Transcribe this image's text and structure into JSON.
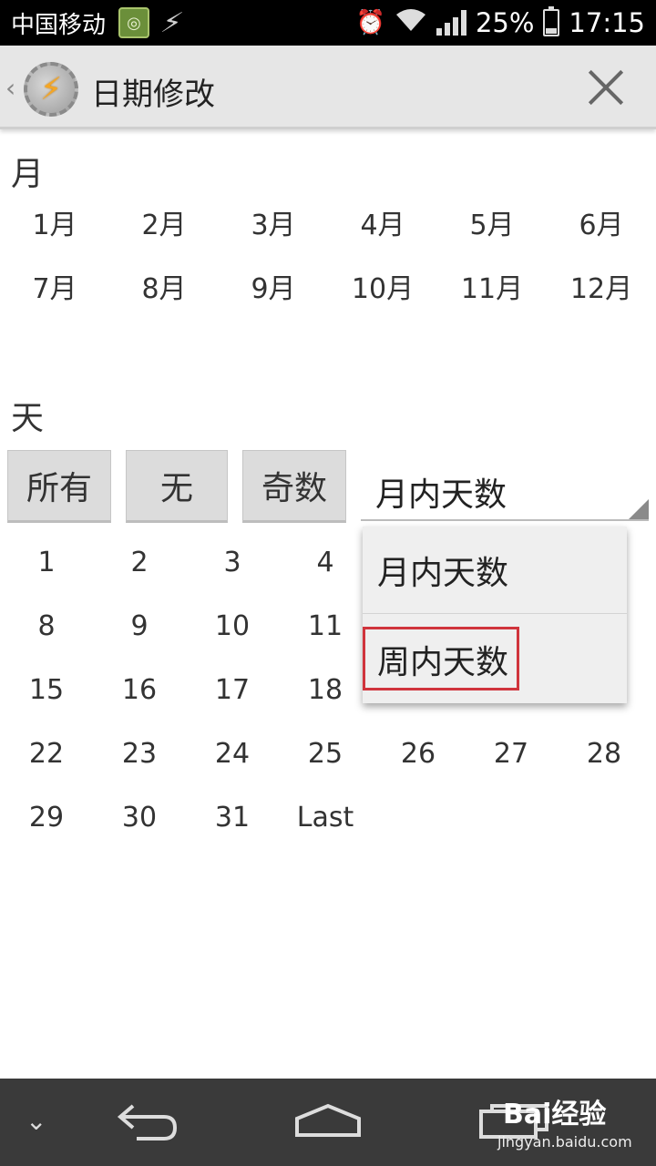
{
  "status_bar": {
    "carrier": "中国移动",
    "battery": "25%",
    "time": "17:15",
    "battery_level": 0.25,
    "icons": [
      "notification-app-icon",
      "flash-icon",
      "alarm-icon",
      "wifi-icon",
      "signal-icon",
      "battery-icon"
    ]
  },
  "title_bar": {
    "back_glyph": "‹",
    "title": "日期修改",
    "icons": [
      "back-chevron-icon",
      "app-lightning-gear-icon",
      "close-icon"
    ]
  },
  "month_section": {
    "label": "月",
    "months": [
      "1月",
      "2月",
      "3月",
      "4月",
      "5月",
      "6月",
      "7月",
      "8月",
      "9月",
      "10月",
      "11月",
      "12月"
    ]
  },
  "day_section": {
    "label": "天",
    "buttons": {
      "all": "所有",
      "none": "无",
      "odd": "奇数"
    },
    "spinner_value": "月内天数",
    "days_row1": [
      "1",
      "2",
      "3",
      "4"
    ],
    "days_row2": [
      "8",
      "9",
      "10",
      "11"
    ],
    "days_row3": [
      "15",
      "16",
      "17",
      "18"
    ],
    "days_row4": [
      "22",
      "23",
      "24",
      "25",
      "26",
      "27",
      "28"
    ],
    "days_row5": [
      "29",
      "30",
      "31",
      "Last"
    ]
  },
  "dropdown": {
    "options": [
      "月内天数",
      "周内天数"
    ],
    "highlight_color": "#d0343c"
  },
  "nav_bar": {
    "down_glyph": "⌄",
    "watermark": "Bai经验",
    "watermark_sub": "jingyan.baidu.com",
    "icons": [
      "collapse-icon",
      "back-icon",
      "home-icon",
      "recent-apps-icon"
    ]
  }
}
